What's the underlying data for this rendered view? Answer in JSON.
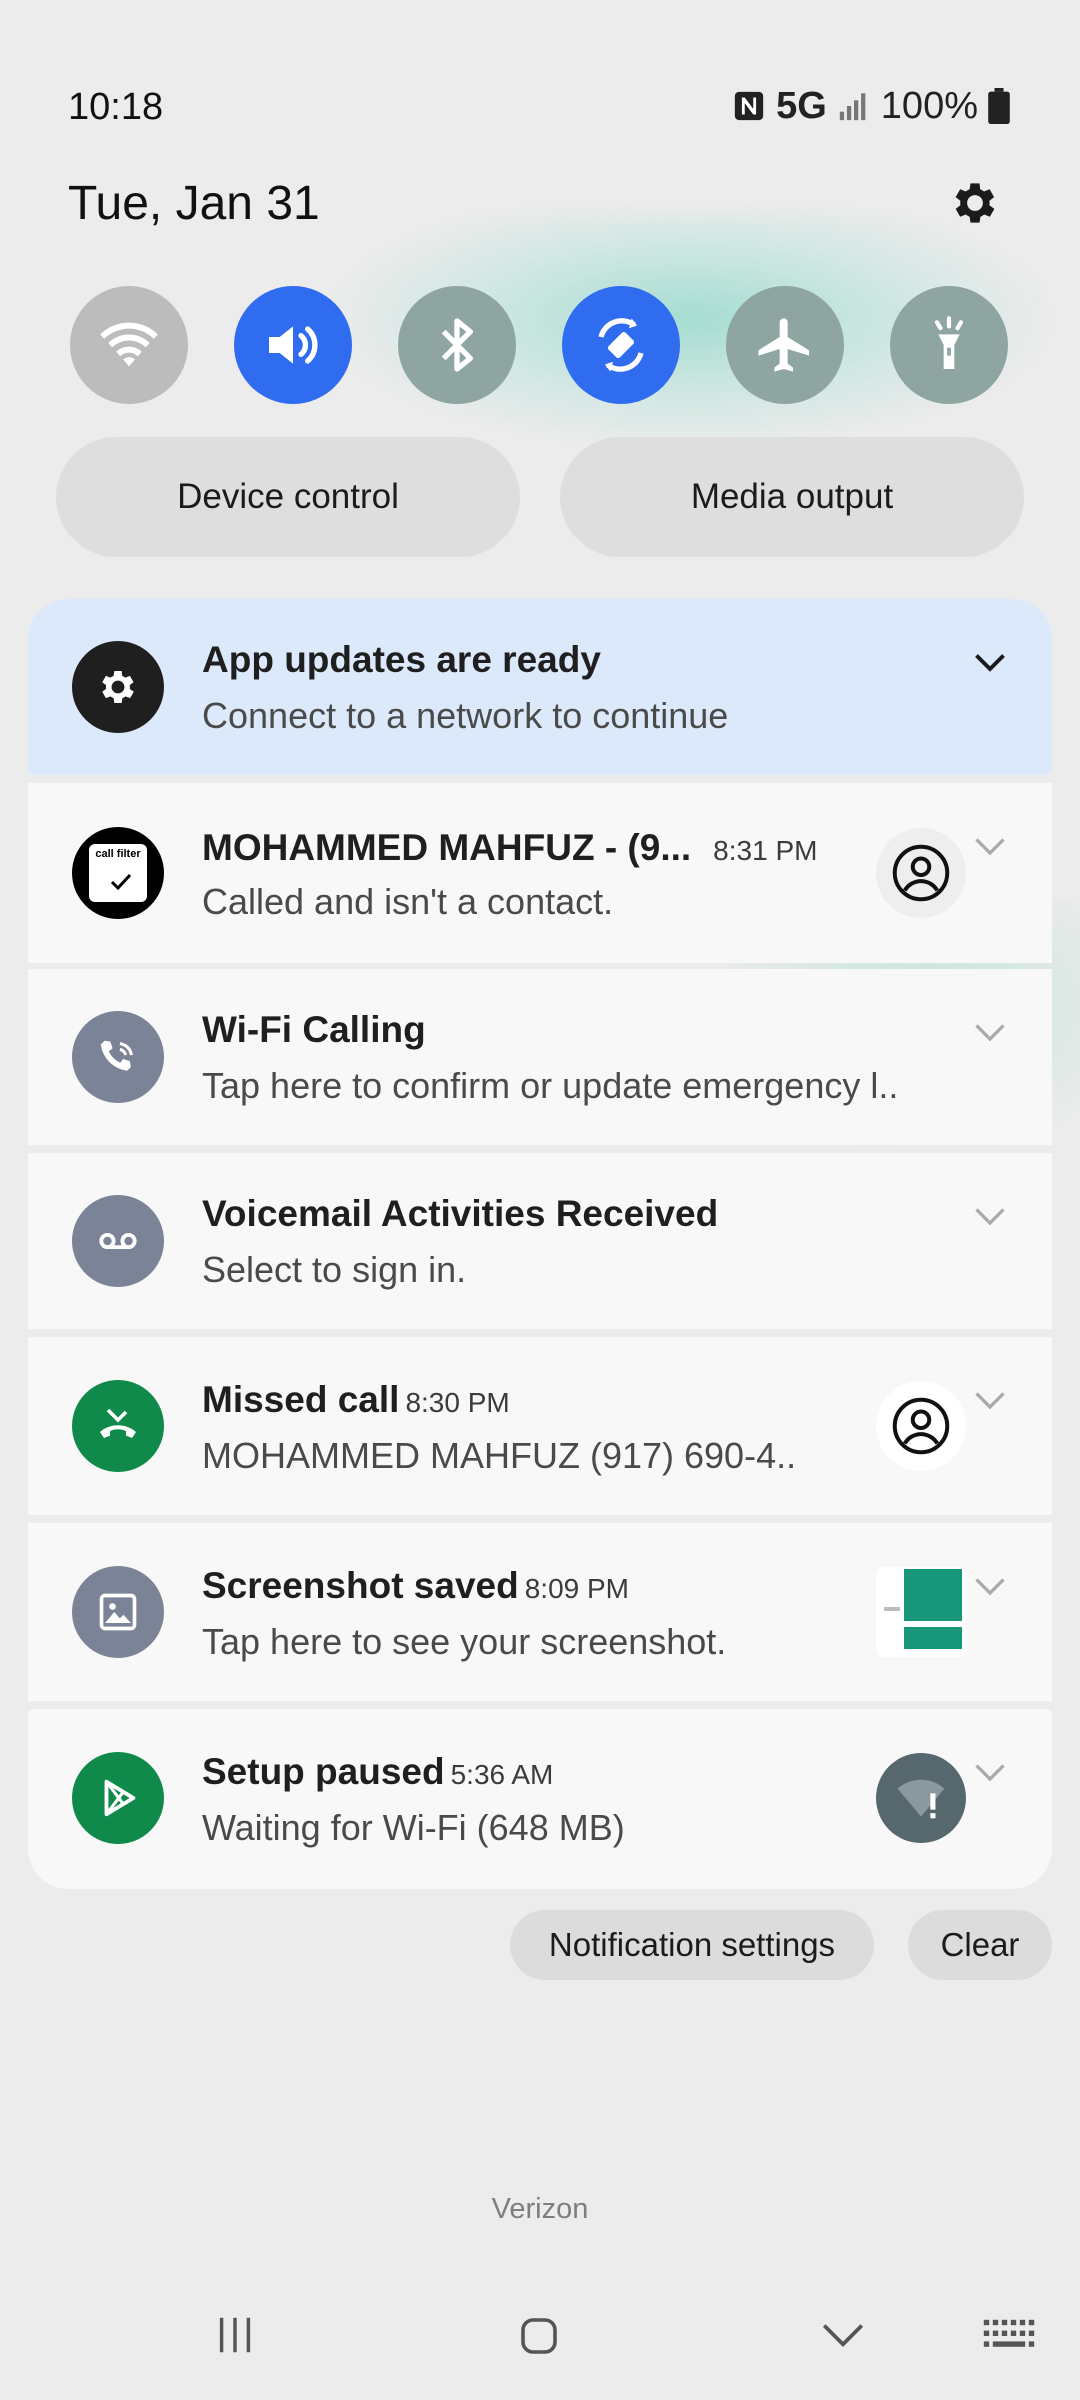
{
  "status_bar": {
    "time": "10:18",
    "network": "5G",
    "battery": "100%"
  },
  "header": {
    "date": "Tue, Jan 31",
    "settings_icon": "gear-icon"
  },
  "quick_toggles": [
    {
      "name": "wifi",
      "icon": "wifi-icon",
      "state": "off"
    },
    {
      "name": "sound",
      "icon": "volume-icon",
      "state": "on"
    },
    {
      "name": "bluetooth",
      "icon": "bluetooth-icon",
      "state": "off"
    },
    {
      "name": "auto-rotate",
      "icon": "rotate-icon",
      "state": "on"
    },
    {
      "name": "airplane-mode",
      "icon": "airplane-icon",
      "state": "off"
    },
    {
      "name": "flashlight",
      "icon": "flashlight-icon",
      "state": "off"
    }
  ],
  "buttons": {
    "device_control": "Device control",
    "media_output": "Media output",
    "notification_settings": "Notification settings",
    "clear": "Clear"
  },
  "notifications": [
    {
      "title": "App updates are ready",
      "time": "",
      "body": "Connect to a network to continue",
      "icon": "gear-icon"
    },
    {
      "title": "MOHAMMED MAHFUZ - (9...",
      "time": "8:31 PM",
      "body": "Called and isn't a contact.",
      "icon": "call-filter-icon",
      "icon_text": "call filter"
    },
    {
      "title": "Wi-Fi Calling",
      "time": "",
      "body": "Tap here to confirm or update emergency l..",
      "icon": "wifi-calling-icon"
    },
    {
      "title": "Voicemail Activities Received",
      "time": "",
      "body": "Select to sign in.",
      "icon": "voicemail-icon"
    },
    {
      "title": "Missed call",
      "time": "8:30 PM",
      "body": "MOHAMMED MAHFUZ (917) 690-4..",
      "icon": "missed-call-icon"
    },
    {
      "title": "Screenshot saved",
      "time": "8:09 PM",
      "body": "Tap here to see your screenshot.",
      "icon": "image-icon"
    },
    {
      "title": "Setup paused",
      "time": "5:36 AM",
      "body": "Waiting for Wi-Fi (648 MB)",
      "icon": "play-store-icon"
    }
  ],
  "carrier": "Verizon",
  "colors": {
    "accent_blue": "#2f6cf0",
    "teal_toggle": "#8ea5a1",
    "first_card": "#dbe9fb",
    "green": "#0f8a4a"
  }
}
